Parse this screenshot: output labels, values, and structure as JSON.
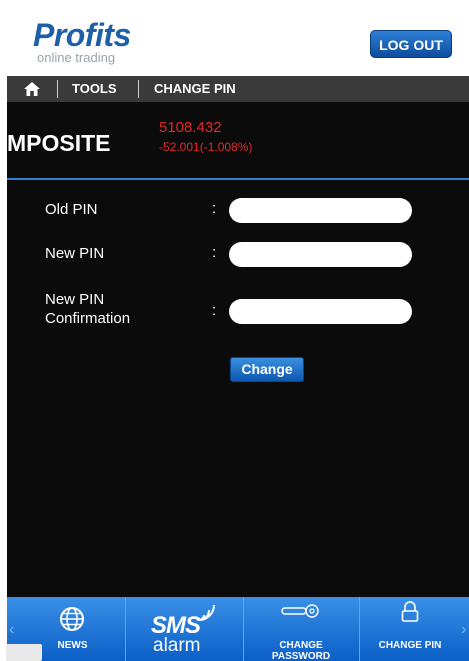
{
  "header": {
    "brand": "Profits",
    "brand_sub": "online trading",
    "logout_label": "LOG OUT"
  },
  "breadcrumb": {
    "home_icon": "home-icon",
    "items": [
      "TOOLS",
      "CHANGE PIN"
    ]
  },
  "ticker": {
    "name": "MPOSITE",
    "price": "5108.432",
    "change": "-52.001(-1.008%)"
  },
  "form": {
    "fields": [
      {
        "label": "Old PIN",
        "value": "",
        "placeholder": ""
      },
      {
        "label": "New PIN",
        "value": "",
        "placeholder": ""
      },
      {
        "label": "New PIN Confirmation",
        "value": "",
        "placeholder": ""
      }
    ],
    "separator": ":",
    "submit_label": "Change"
  },
  "bottom_nav": {
    "items": [
      {
        "label": "NEWS",
        "icon": "globe-icon"
      },
      {
        "label": "SMS alarm",
        "icon": "sms-alarm-icon",
        "logo_text": "SMS",
        "logo_sub": "alarm"
      },
      {
        "label": "CHANGE PASSWORD",
        "icon": "key-icon"
      },
      {
        "label": "CHANGE PIN",
        "icon": "lock-icon"
      }
    ],
    "prev_arrow": "‹",
    "next_arrow": "›"
  },
  "colors": {
    "brand": "#1d5fa8",
    "accent": "#2f7fd0",
    "negative": "#e02a2a"
  }
}
